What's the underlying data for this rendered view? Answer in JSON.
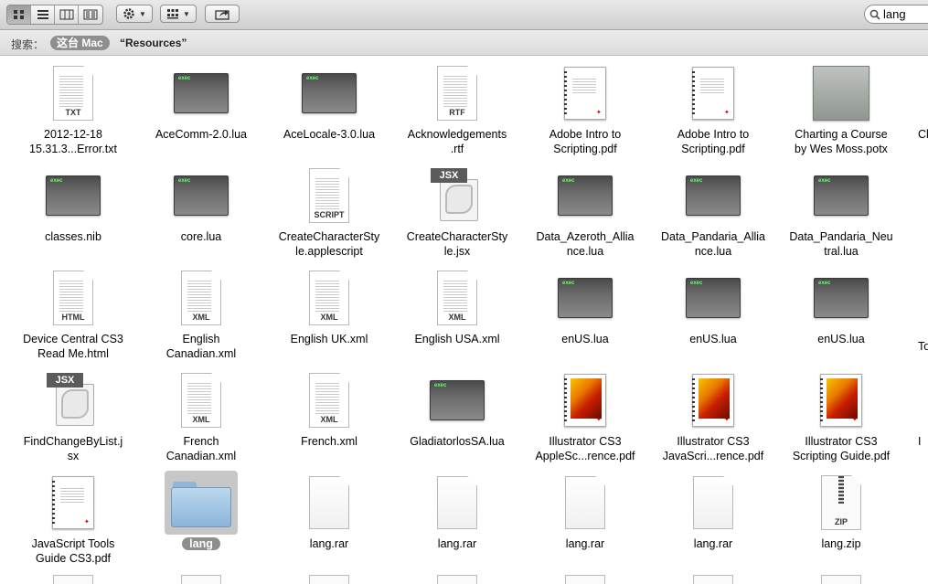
{
  "search": {
    "value": "lang"
  },
  "scope": {
    "label": "搜索：",
    "pill": "这台 Mac",
    "folder": "“Resources”"
  },
  "files": [
    {
      "name": [
        "2012-12-18",
        "15.31.3...Error.txt"
      ],
      "icon": "txt-document-icon",
      "tag": "TXT"
    },
    {
      "name": [
        "AceComm-2.0.lua"
      ],
      "icon": "exec-icon",
      "tag": "exec"
    },
    {
      "name": [
        "AceLocale-3.0.lua"
      ],
      "icon": "exec-icon",
      "tag": "exec"
    },
    {
      "name": [
        "Acknowledgements",
        ".rtf"
      ],
      "icon": "rtf-document-icon",
      "tag": "RTF"
    },
    {
      "name": [
        "Adobe Intro to",
        "Scripting.pdf"
      ],
      "icon": "pdf-document-icon",
      "tag": ""
    },
    {
      "name": [
        "Adobe Intro to",
        "Scripting.pdf"
      ],
      "icon": "pdf-document-icon",
      "tag": ""
    },
    {
      "name": [
        "Charting a Course",
        "by Wes Moss.potx"
      ],
      "icon": "potx-template-icon",
      "tag": ""
    },
    {
      "name": [
        "classes.nib"
      ],
      "icon": "exec-icon",
      "tag": "exec"
    },
    {
      "name": [
        "core.lua"
      ],
      "icon": "exec-icon",
      "tag": "exec"
    },
    {
      "name": [
        "CreateCharacterSty",
        "le.applescript"
      ],
      "icon": "script-document-icon",
      "tag": "SCRIPT"
    },
    {
      "name": [
        "CreateCharacterSty",
        "le.jsx"
      ],
      "icon": "jsx-file-icon",
      "tag": "JSX"
    },
    {
      "name": [
        "Data_Azeroth_Allia",
        "nce.lua"
      ],
      "icon": "exec-icon",
      "tag": "exec"
    },
    {
      "name": [
        "Data_Pandaria_Allia",
        "nce.lua"
      ],
      "icon": "exec-icon",
      "tag": "exec"
    },
    {
      "name": [
        "Data_Pandaria_Neu",
        "tral.lua"
      ],
      "icon": "exec-icon",
      "tag": "exec"
    },
    {
      "name": [
        "Device Central CS3",
        "Read Me.html"
      ],
      "icon": "html-document-icon",
      "tag": "HTML"
    },
    {
      "name": [
        "English",
        "Canadian.xml"
      ],
      "icon": "xml-document-icon",
      "tag": "XML"
    },
    {
      "name": [
        "English UK.xml"
      ],
      "icon": "xml-document-icon",
      "tag": "XML"
    },
    {
      "name": [
        "English USA.xml"
      ],
      "icon": "xml-document-icon",
      "tag": "XML"
    },
    {
      "name": [
        "enUS.lua"
      ],
      "icon": "exec-icon",
      "tag": "exec"
    },
    {
      "name": [
        "enUS.lua"
      ],
      "icon": "exec-icon",
      "tag": "exec"
    },
    {
      "name": [
        "enUS.lua"
      ],
      "icon": "exec-icon",
      "tag": "exec"
    },
    {
      "name": [
        "FindChangeByList.j",
        "sx"
      ],
      "icon": "jsx-file-icon",
      "tag": "JSX"
    },
    {
      "name": [
        "French",
        "Canadian.xml"
      ],
      "icon": "xml-document-icon",
      "tag": "XML"
    },
    {
      "name": [
        "French.xml"
      ],
      "icon": "xml-document-icon",
      "tag": "XML"
    },
    {
      "name": [
        "GladiatorlosSA.lua"
      ],
      "icon": "exec-icon",
      "tag": "exec"
    },
    {
      "name": [
        "Illustrator CS3",
        "AppleSc...rence.pdf"
      ],
      "icon": "illustrator-pdf-icon",
      "tag": ""
    },
    {
      "name": [
        "Illustrator CS3",
        "JavaScri...rence.pdf"
      ],
      "icon": "illustrator-pdf-icon",
      "tag": ""
    },
    {
      "name": [
        "Illustrator CS3",
        "Scripting Guide.pdf"
      ],
      "icon": "illustrator-pdf-icon",
      "tag": ""
    },
    {
      "name": [
        "JavaScript Tools",
        "Guide CS3.pdf"
      ],
      "icon": "pdf-document-icon",
      "tag": ""
    },
    {
      "name": [
        "lang"
      ],
      "icon": "folder-icon",
      "tag": "",
      "selected": true
    },
    {
      "name": [
        "lang.rar"
      ],
      "icon": "blank-document-icon",
      "tag": ""
    },
    {
      "name": [
        "lang.rar"
      ],
      "icon": "blank-document-icon",
      "tag": ""
    },
    {
      "name": [
        "lang.rar"
      ],
      "icon": "blank-document-icon",
      "tag": ""
    },
    {
      "name": [
        "lang.rar"
      ],
      "icon": "blank-document-icon",
      "tag": ""
    },
    {
      "name": [
        "lang.zip"
      ],
      "icon": "zip-archive-icon",
      "tag": "ZIP"
    }
  ],
  "clipped_column": [
    "Cl",
    "To",
    "I"
  ]
}
